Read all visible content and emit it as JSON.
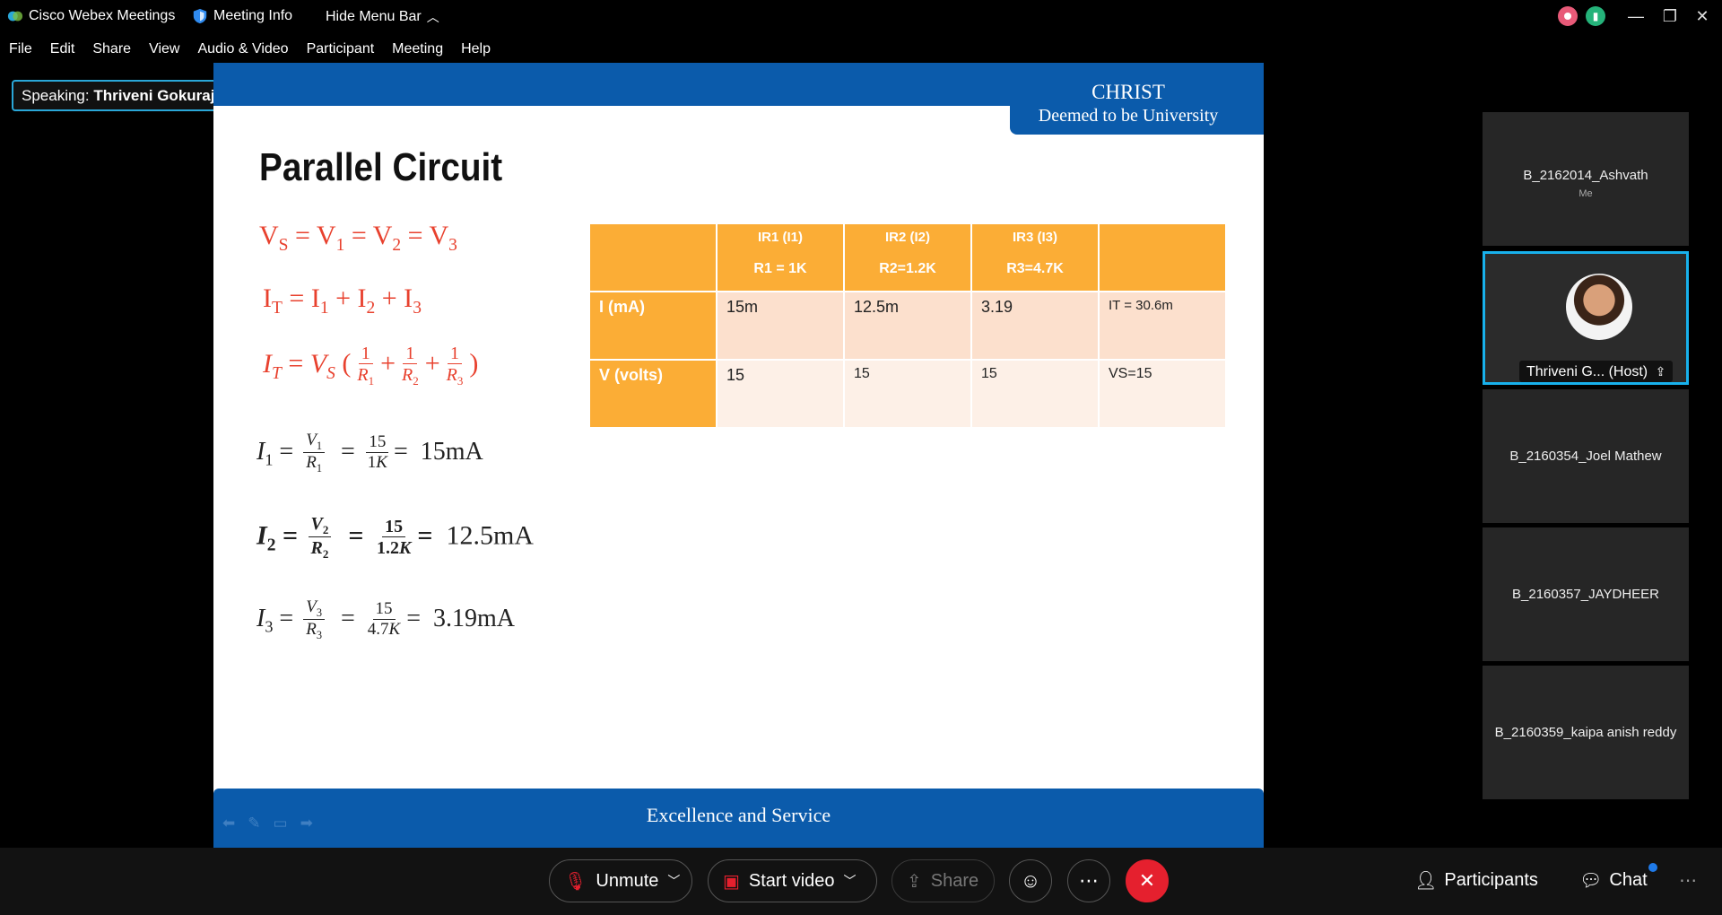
{
  "titlebar": {
    "app_name": "Cisco Webex Meetings",
    "meeting_info": "Meeting Info",
    "hide_menu": "Hide Menu Bar"
  },
  "menu": [
    "File",
    "Edit",
    "Share",
    "View",
    "Audio & Video",
    "Participant",
    "Meeting",
    "Help"
  ],
  "speaking": {
    "label": "Speaking:",
    "name": "Thriveni Gokuraju ECE (Host)"
  },
  "slide": {
    "logo_line1": "CHRIST",
    "logo_line2": "Deemed to be University",
    "title": "Parallel Circuit",
    "footer": "Excellence and Service",
    "eq_i1_result": "15mA",
    "eq_i2_result": "12.5mA",
    "eq_i3_result": "3.19mA",
    "table": {
      "headers": [
        {
          "top": "IR1 (I1)",
          "bottom": "R1 = 1K"
        },
        {
          "top": "IR2 (I2)",
          "bottom": "R2=1.2K"
        },
        {
          "top": "IR3 (I3)",
          "bottom": "R3=4.7K"
        }
      ],
      "rows": [
        {
          "label": "I (mA)",
          "cells": [
            "15m",
            "12.5m",
            "3.19",
            "IT = 30.6m"
          ]
        },
        {
          "label": "V (volts)",
          "cells": [
            "15",
            "15",
            "15",
            "VS=15"
          ]
        }
      ]
    }
  },
  "participants": [
    {
      "name": "B_2162014_Ashvath",
      "sub": "Me"
    },
    {
      "name": "Thriveni G... (Host)",
      "sub": ""
    },
    {
      "name": "B_2160354_Joel Mathew",
      "sub": ""
    },
    {
      "name": "B_2160357_JAYDHEER",
      "sub": ""
    },
    {
      "name": "B_2160359_kaipa anish reddy",
      "sub": ""
    }
  ],
  "controls": {
    "unmute": "Unmute",
    "start_video": "Start video",
    "share": "Share",
    "participants": "Participants",
    "chat": "Chat"
  },
  "colors": {
    "accent": "#18b1ec",
    "slide_blue": "#0b5bab",
    "table_orange": "#fbad36",
    "end_red": "#e5202e"
  }
}
